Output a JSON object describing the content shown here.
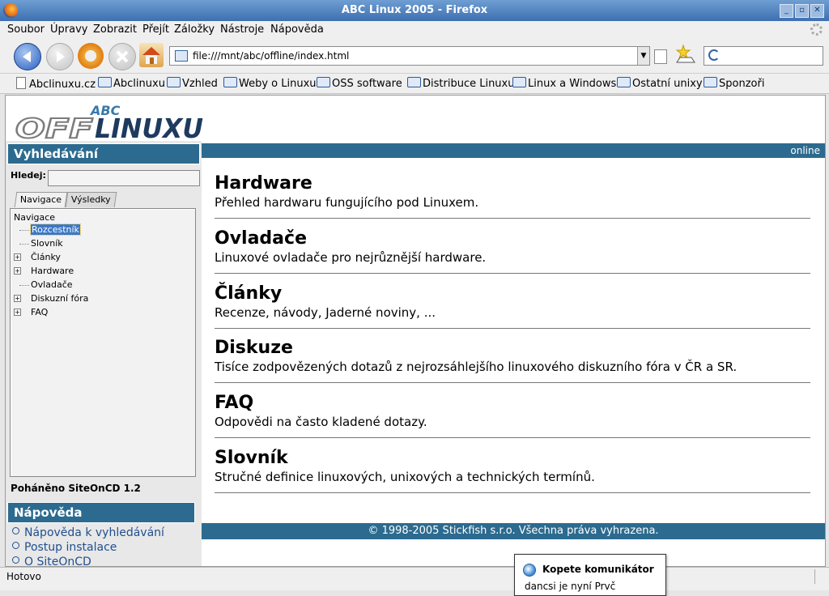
{
  "window": {
    "title": "ABC Linux 2005 - Firefox",
    "controls": [
      "_",
      "▫",
      "✕"
    ]
  },
  "menu": [
    "Soubor",
    "Úpravy",
    "Zobrazit",
    "Přejít",
    "Záložky",
    "Nástroje",
    "Nápověda"
  ],
  "url": "file:///mnt/abc/offline/index.html",
  "bookmarks": [
    "Abclinuxu.cz",
    "Abclinuxu",
    "Vzhled",
    "Weby o Linuxu",
    "OSS software",
    "Distribuce Linuxu",
    "Linux a Windows",
    "Ostatní unixy",
    "Sponzoři"
  ],
  "logo": {
    "top": "ABC",
    "main": "OFFLINUXU"
  },
  "search": {
    "heading": "Vyhledávání",
    "label": "Hledej:",
    "value": ""
  },
  "tabs": [
    "Navigace",
    "Výsledky"
  ],
  "tree": {
    "title": "Navigace",
    "items": [
      {
        "label": "Rozcestník",
        "expandable": false,
        "selected": true
      },
      {
        "label": "Slovník",
        "expandable": false,
        "selected": false
      },
      {
        "label": "Články",
        "expandable": true,
        "selected": false
      },
      {
        "label": "Hardware",
        "expandable": true,
        "selected": false
      },
      {
        "label": "Ovladače",
        "expandable": false,
        "selected": false
      },
      {
        "label": "Diskuzní fóra",
        "expandable": true,
        "selected": false
      },
      {
        "label": "FAQ",
        "expandable": true,
        "selected": false
      }
    ]
  },
  "powered": "Poháněno SiteOnCD 1.2",
  "help": {
    "heading": "Nápověda",
    "links": [
      "Nápověda k vyhledávání",
      "Postup instalace",
      "O SiteOnCD"
    ]
  },
  "status_strip": "online",
  "sections": [
    {
      "title": "Hardware",
      "desc": "Přehled hardwaru fungujícího pod Linuxem."
    },
    {
      "title": "Ovladače",
      "desc": "Linuxové ovladače pro nejrůznější hardware."
    },
    {
      "title": "Články",
      "desc": "Recenze, návody, Jaderné noviny, ..."
    },
    {
      "title": "Diskuze",
      "desc": "Tisíce zodpovězených dotazů z nejrozsáhlejšího linuxového diskuzního fóra v ČR a SR."
    },
    {
      "title": "FAQ",
      "desc": "Odpovědi na často kladené dotazy."
    },
    {
      "title": "Slovník",
      "desc": "Stručné definice linuxových, unixových a technických termínů."
    }
  ],
  "footer": "© 1998-2005 Stickfish s.r.o. Všechna práva vyhrazena.",
  "statusbar": "Hotovo",
  "notification": {
    "title": "Kopete komunikátor",
    "body": "dancsi je nyní Prvč"
  },
  "colors": {
    "header_blue": "#2c6b8f",
    "title_bar": "#3d6fb0",
    "link": "#1f4f8f"
  }
}
